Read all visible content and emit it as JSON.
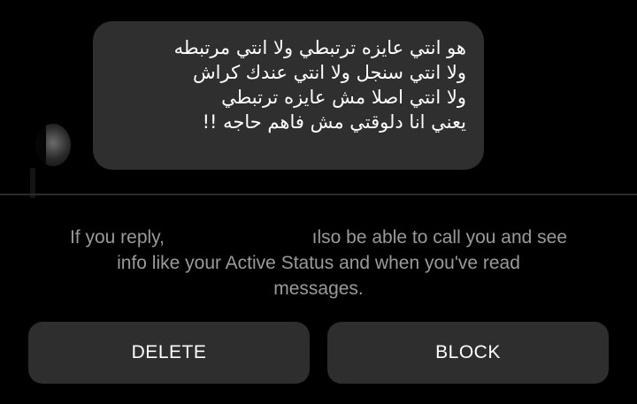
{
  "message": {
    "lines": [
      "هو انتي عايزه ترتبطي ولا انتي مرتبطه",
      "ولا انتي سنجل ولا انتي عندك كراش",
      "ولا انتي اصلا مش عايزه ترتبطي",
      "يعني انا دلوقتي مش فاهم حاجه !!"
    ]
  },
  "notice": {
    "prefix": "If you reply,",
    "suffix": "ılso be able to call you and see",
    "line2": "info like your Active Status and when you've read",
    "line3": "messages."
  },
  "actions": {
    "delete_label": "DELETE",
    "block_label": "BLOCK"
  },
  "colors": {
    "background": "#000000",
    "bubble": "#2f2f2f",
    "button": "#2e2e2e",
    "notice_text": "#9a9a9a"
  }
}
